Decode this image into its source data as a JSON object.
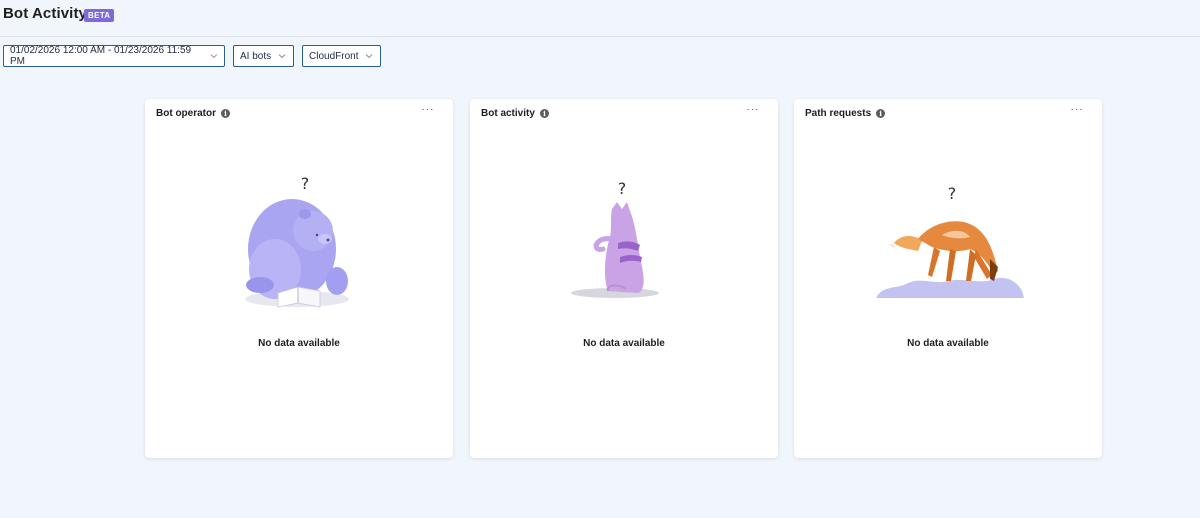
{
  "header": {
    "title": "Bot Activity",
    "badge": "BETA"
  },
  "filters": {
    "date_range": "01/02/2026 12:00 AM - 01/23/2026 11:59 PM",
    "bot_type": "AI bots",
    "source": "CloudFront"
  },
  "cards": [
    {
      "title": "Bot operator",
      "info": "i",
      "more": "···",
      "question_mark": "?",
      "empty_text": "No data available",
      "illustration": "bear-reading-book"
    },
    {
      "title": "Bot activity",
      "info": "i",
      "more": "···",
      "question_mark": "?",
      "empty_text": "No data available",
      "illustration": "cat-sitting"
    },
    {
      "title": "Path requests",
      "info": "i",
      "more": "···",
      "question_mark": "?",
      "empty_text": "No data available",
      "illustration": "fox-sniffing-snow"
    }
  ],
  "colors": {
    "background": "#f1f5fc",
    "accent_border": "#2a5b9b",
    "badge": "#7f6bd8",
    "bear": "#a7a3f0",
    "cat": "#c9a3e6",
    "fox": "#e4893e",
    "snow": "#c3c3f2"
  }
}
